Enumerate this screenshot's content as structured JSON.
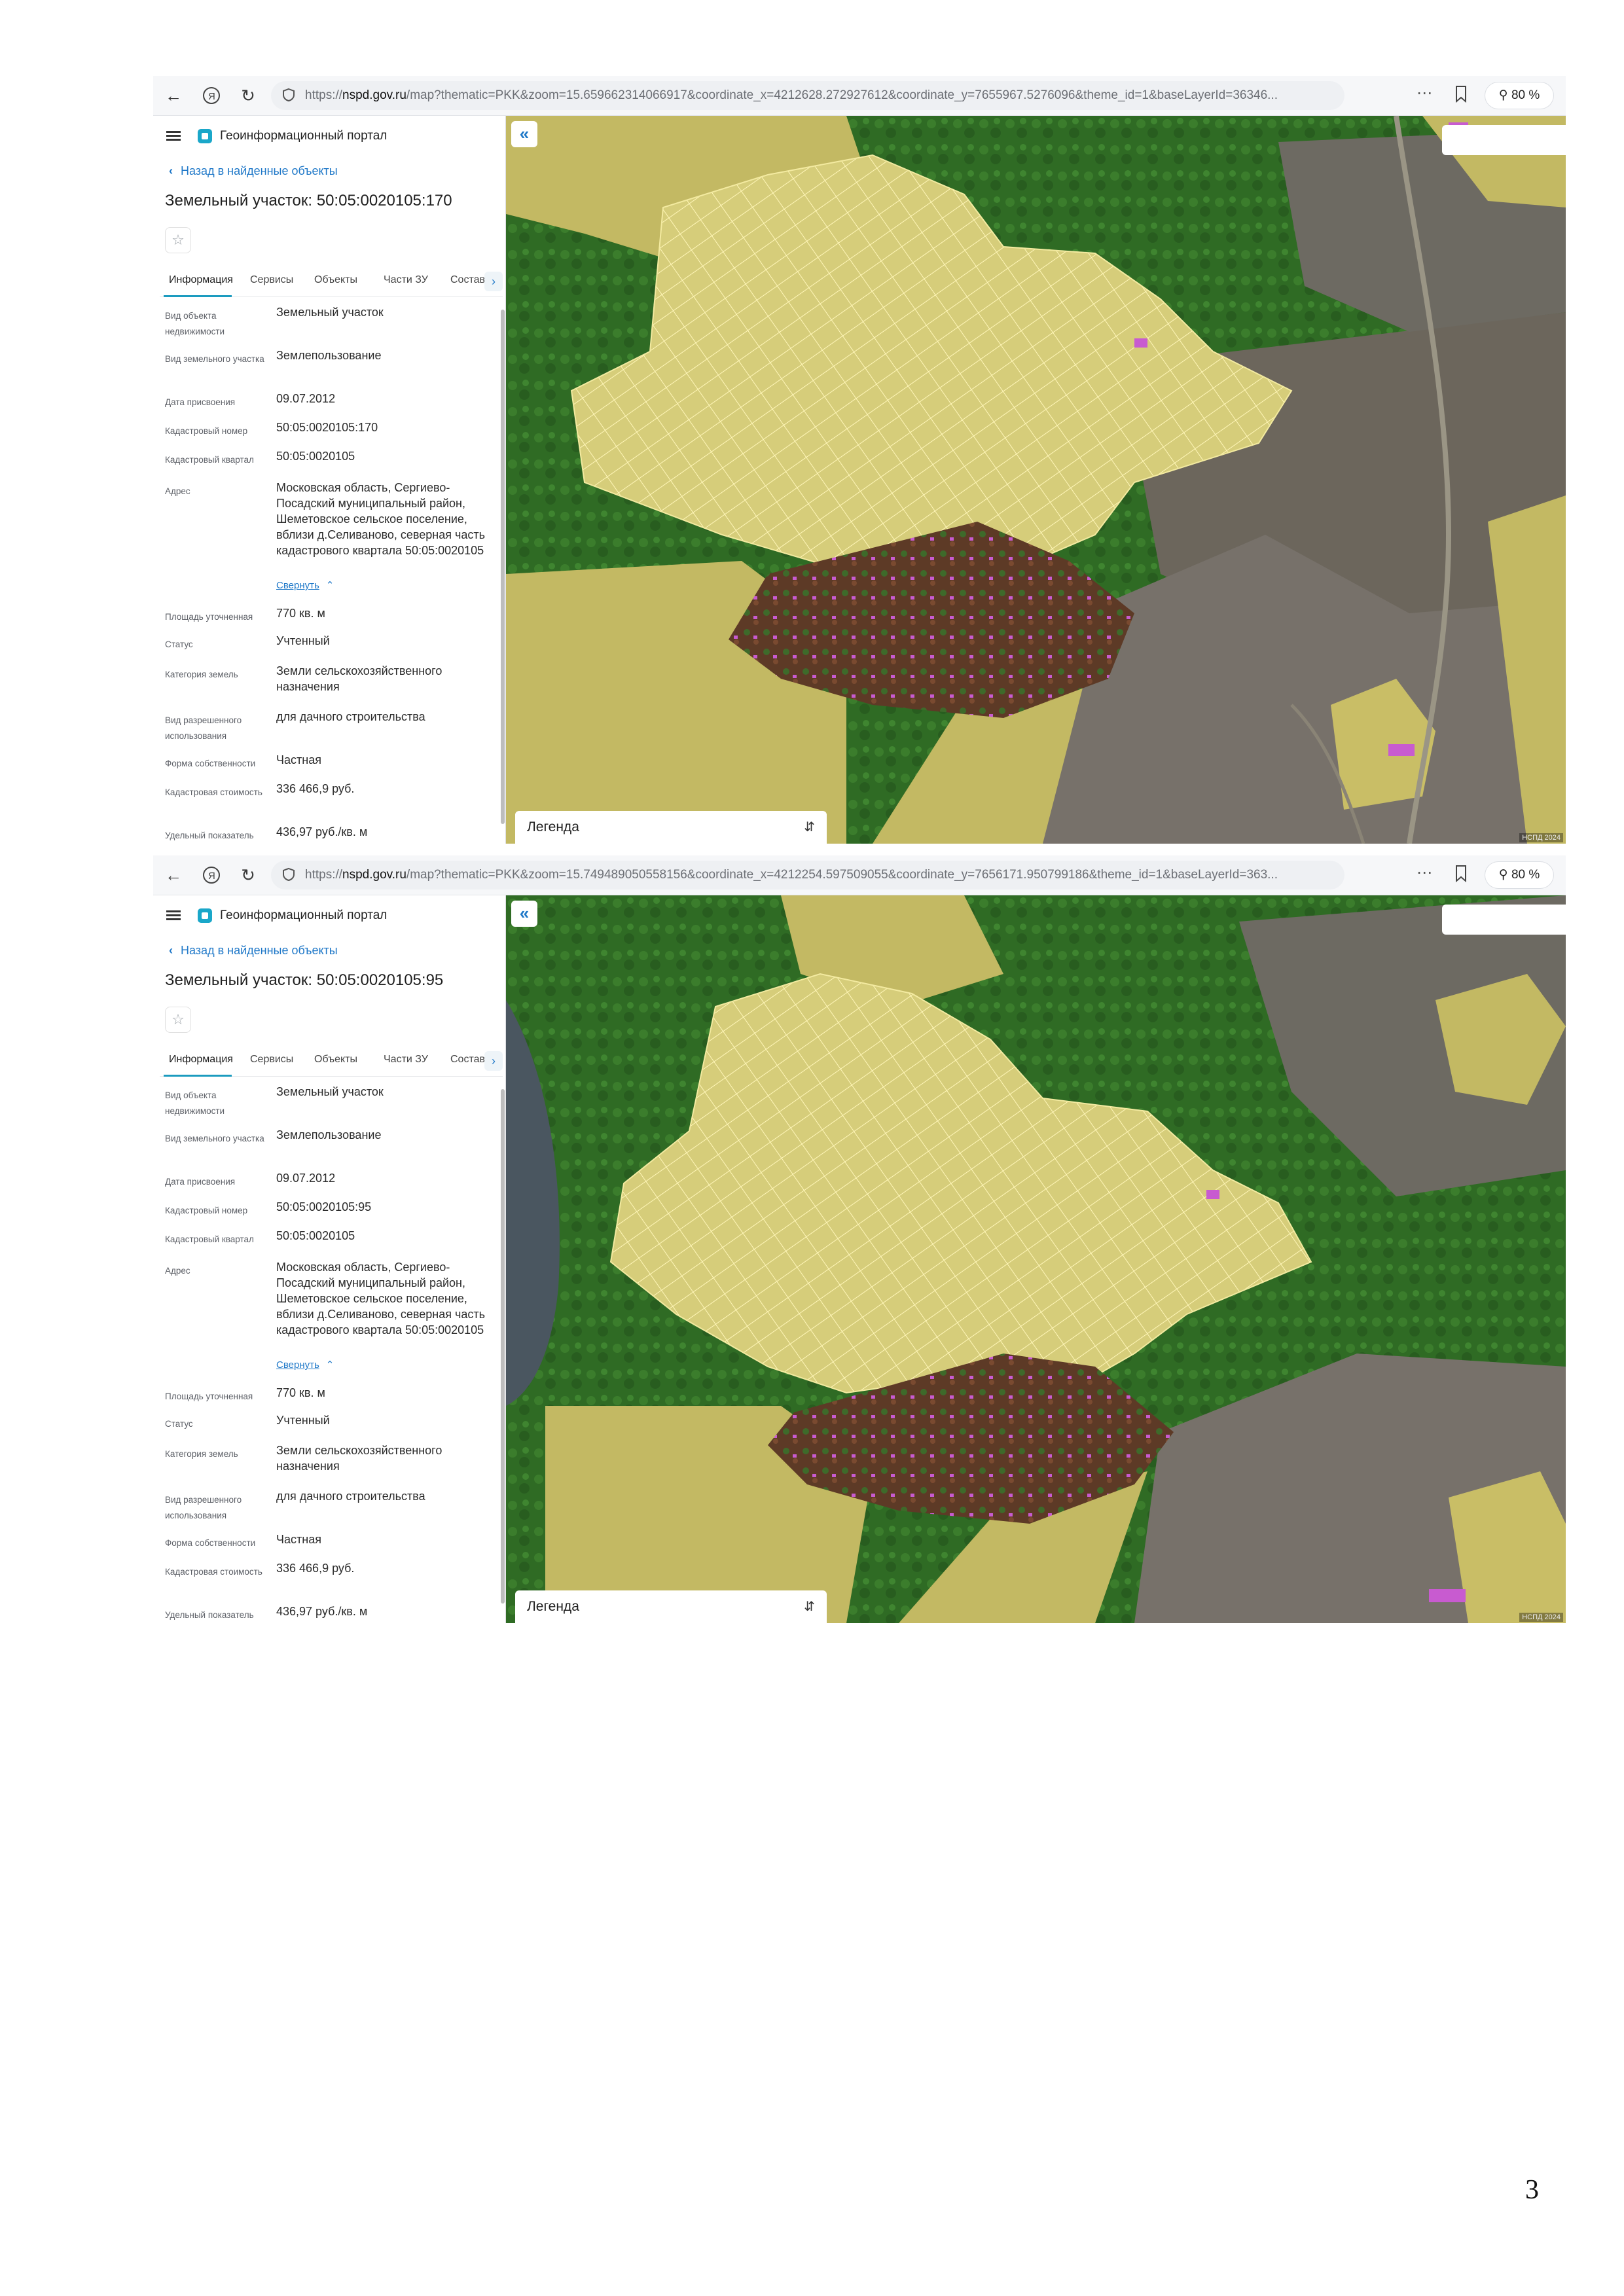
{
  "screenshots": [
    {
      "url_prefix": "https://",
      "url_domain": "nspd.gov.ru",
      "url_rest": "/map?thematic=PKK&zoom=15.659662314066917&coordinate_x=4212628.272927612&coordinate_y=7655967.5276096&theme_id=1&baseLayerId=36346...",
      "zoom_label": "80 %",
      "portal_name": "Геоинформационный портал",
      "back_link": "Назад в найденные объекты",
      "title": "Земельный участок: 50:05:0020105:170",
      "tabs": [
        "Информация",
        "Сервисы",
        "Объекты",
        "Части ЗУ",
        "Состав"
      ],
      "fields": [
        {
          "label": "Вид объекта недвижимости",
          "value": "Земельный участок"
        },
        {
          "label": "Вид земельного участка",
          "value": "Землепользование"
        },
        {
          "label": "Дата присвоения",
          "value": "09.07.2012"
        },
        {
          "label": "Кадастровый номер",
          "value": "50:05:0020105:170"
        },
        {
          "label": "Кадастровый квартал",
          "value": "50:05:0020105"
        },
        {
          "label": "Адрес",
          "value": "Московская область, Сергиево-Посадский муниципальный район, Шеметовское сельское поселение, вблизи д.Селиваново, северная часть кадастрового квартала 50:05:0020105"
        },
        {
          "label": "Площадь уточненная",
          "value": "770 кв. м"
        },
        {
          "label": "Статус",
          "value": "Учтенный"
        },
        {
          "label": "Категория земель",
          "value": "Земли сельскохозяйственного назначения"
        },
        {
          "label": "Вид разрешенного использования",
          "value": "для дачного строительства"
        },
        {
          "label": "Форма собственности",
          "value": "Частная"
        },
        {
          "label": "Кадастровая стоимость",
          "value": "336 466,9 руб."
        },
        {
          "label": "Удельный показатель кадастровой",
          "value": "436,97 руб./кв. м"
        }
      ],
      "collapse_link": "Свернуть",
      "legend_label": "Легенда",
      "map_attribution": "НСПД 2024"
    },
    {
      "url_prefix": "https://",
      "url_domain": "nspd.gov.ru",
      "url_rest": "/map?thematic=PKK&zoom=15.749489050558156&coordinate_x=4212254.597509055&coordinate_y=7656171.950799186&theme_id=1&baseLayerId=363...",
      "zoom_label": "80 %",
      "portal_name": "Геоинформационный портал",
      "back_link": "Назад в найденные объекты",
      "title": "Земельный участок: 50:05:0020105:95",
      "tabs": [
        "Информация",
        "Сервисы",
        "Объекты",
        "Части ЗУ",
        "Состав"
      ],
      "fields": [
        {
          "label": "Вид объекта недвижимости",
          "value": "Земельный участок"
        },
        {
          "label": "Вид земельного участка",
          "value": "Землепользование"
        },
        {
          "label": "Дата присвоения",
          "value": "09.07.2012"
        },
        {
          "label": "Кадастровый номер",
          "value": "50:05:0020105:95"
        },
        {
          "label": "Кадастровый квартал",
          "value": "50:05:0020105"
        },
        {
          "label": "Адрес",
          "value": "Московская область, Сергиево-Посадский муниципальный район, Шеметовское сельское поселение, вблизи д.Селиваново, северная часть кадастрового квартала 50:05:0020105"
        },
        {
          "label": "Площадь уточненная",
          "value": "770 кв. м"
        },
        {
          "label": "Статус",
          "value": "Учтенный"
        },
        {
          "label": "Категория земель",
          "value": "Земли сельскохозяйственного назначения"
        },
        {
          "label": "Вид разрешенного использования",
          "value": "для дачного строительства"
        },
        {
          "label": "Форма собственности",
          "value": "Частная"
        },
        {
          "label": "Кадастровая стоимость",
          "value": "336 466,9 руб."
        },
        {
          "label": "Удельный показатель кадастровой",
          "value": "436,97 руб./кв. м"
        }
      ],
      "collapse_link": "Свернуть",
      "legend_label": "Легенда",
      "map_attribution": "НСПД 2024"
    }
  ],
  "page_number": "3",
  "colors": {
    "accent": "#1b9bbf",
    "link": "#1f78c8",
    "forest": "#2f6b24",
    "parcel_fill": "#d8cf7c",
    "field_fill": "#c3b963",
    "plowed": "#6a655c",
    "building": "#c85bd0"
  }
}
